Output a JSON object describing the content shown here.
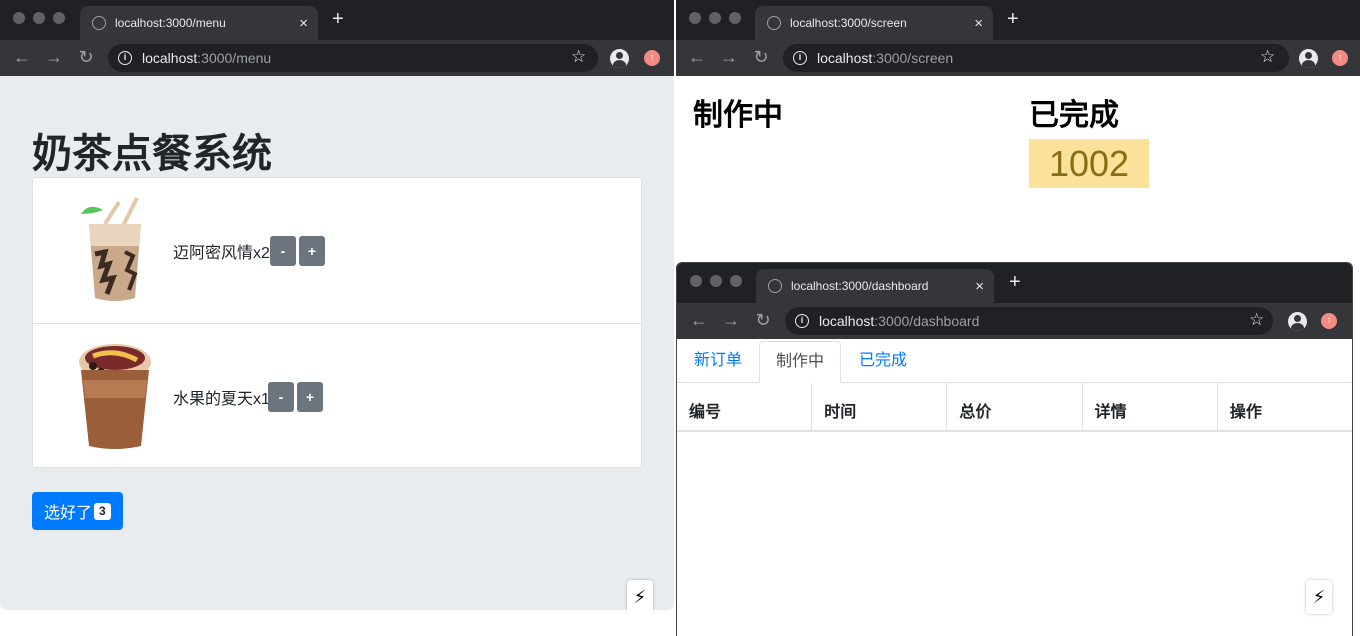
{
  "menu_window": {
    "tab_title": "localhost:3000/menu",
    "url_host": "localhost",
    "url_path": ":3000/menu",
    "page_title": "奶茶点餐系统",
    "items": [
      {
        "label": "迈阿密风情x2",
        "minus": "-",
        "plus": "+"
      },
      {
        "label": "水果的夏天x1",
        "minus": "-",
        "plus": "+"
      }
    ],
    "submit_label": "选好了",
    "submit_count": "3"
  },
  "screen_window": {
    "tab_title": "localhost:3000/screen",
    "url_host": "localhost",
    "url_path": ":3000/screen",
    "in_progress_heading": "制作中",
    "done_heading": "已完成",
    "done_orders": [
      "1002"
    ]
  },
  "dashboard_window": {
    "tab_title": "localhost:3000/dashboard",
    "url_host": "localhost",
    "url_path": ":3000/dashboard",
    "tabs": [
      "新订单",
      "制作中",
      "已完成"
    ],
    "active_tab": "制作中",
    "columns": [
      "编号",
      "时间",
      "总价",
      "详情",
      "操作"
    ]
  },
  "browser": {
    "new_tab": "+",
    "close": "×",
    "back": "←",
    "forward": "→",
    "reload": "↻",
    "star": "☆",
    "bolt": "⚡"
  },
  "colors": {
    "primary": "#007bff",
    "secondary": "#6c757d",
    "menu_bg": "#e9ecef",
    "chip_bg": "#fbe29a",
    "chip_text": "#8a6d15",
    "chrome_dark": "#202124",
    "chrome_toolbar": "#35363a"
  }
}
